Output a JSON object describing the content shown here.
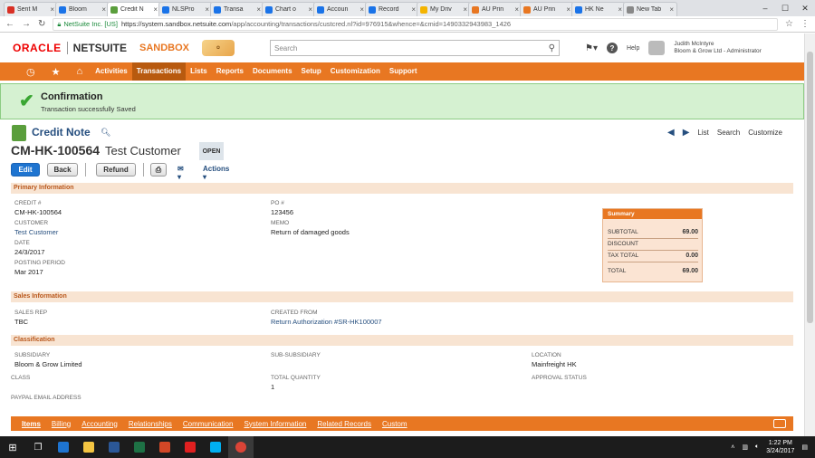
{
  "browser": {
    "tabs": [
      {
        "label": "Sent M",
        "color": "#d93025",
        "active": false
      },
      {
        "label": "Bloom",
        "color": "#1a73e8",
        "active": false
      },
      {
        "label": "Credit N",
        "color": "#5a9e3c",
        "active": true
      },
      {
        "label": "NLSPro",
        "color": "#1a73e8",
        "active": false
      },
      {
        "label": "Transa",
        "color": "#1a73e8",
        "active": false
      },
      {
        "label": "Chart o",
        "color": "#1a73e8",
        "active": false
      },
      {
        "label": "Accoun",
        "color": "#1a73e8",
        "active": false
      },
      {
        "label": "Record",
        "color": "#1a73e8",
        "active": false
      },
      {
        "label": "My Driv",
        "color": "#f4b400",
        "active": false
      },
      {
        "label": "AU Prin",
        "color": "#e87722",
        "active": false
      },
      {
        "label": "AU Prin",
        "color": "#e87722",
        "active": false
      },
      {
        "label": "HK Ne",
        "color": "#1a73e8",
        "active": false
      },
      {
        "label": "New Tab",
        "color": "#888888",
        "active": false
      }
    ],
    "url_secure": "NetSuite Inc. [US]",
    "url_host": "https://system.sandbox.netsuite.com",
    "url_path": "/app/accounting/transactions/custcred.nl?id=976915&whence=&cmid=1490332943983_1426"
  },
  "header": {
    "oracle": "ORACLE",
    "netsuite": "NETSUITE",
    "sandbox": "SANDBOX",
    "search_placeholder": "Search",
    "help": "Help",
    "user_name": "Judith McIntyre",
    "user_role": "Bloom & Grow Ltd - Administrator"
  },
  "nav": {
    "items": [
      "Activities",
      "Transactions",
      "Lists",
      "Reports",
      "Documents",
      "Setup",
      "Customization",
      "Support"
    ],
    "active": "Transactions"
  },
  "confirmation": {
    "title": "Confirmation",
    "subtitle": "Transaction successfully Saved"
  },
  "record": {
    "type": "Credit Note",
    "number": "CM-HK-100564",
    "customer": "Test Customer",
    "status": "OPEN",
    "nav_links": [
      "List",
      "Search",
      "Customize"
    ]
  },
  "buttons": {
    "edit": "Edit",
    "back": "Back",
    "refund": "Refund",
    "actions": "Actions"
  },
  "primary": {
    "heading": "Primary Information",
    "credit_label": "CREDIT #",
    "credit_value": "CM-HK-100564",
    "customer_label": "CUSTOMER",
    "customer_value": "Test Customer",
    "date_label": "DATE",
    "date_value": "24/3/2017",
    "period_label": "POSTING PERIOD",
    "period_value": "Mar 2017",
    "po_label": "PO #",
    "po_value": "123456",
    "memo_label": "MEMO",
    "memo_value": "Return of damaged goods"
  },
  "summary": {
    "heading": "Summary",
    "subtotal_label": "SUBTOTAL",
    "subtotal_value": "69.00",
    "discount_label": "DISCOUNT",
    "tax_label": "TAX TOTAL",
    "tax_value": "0.00",
    "total_label": "TOTAL",
    "total_value": "69.00"
  },
  "sales": {
    "heading": "Sales Information",
    "rep_label": "SALES REP",
    "rep_value": "TBC",
    "created_label": "CREATED FROM",
    "created_value": "Return Authorization #SR-HK100007"
  },
  "classification": {
    "heading": "Classification",
    "subsidiary_label": "SUBSIDIARY",
    "subsidiary_value": "Bloom & Grow Limited",
    "subsub_label": "SUB-SUBSIDIARY",
    "location_label": "LOCATION",
    "location_value": "Mainfreight HK",
    "class_label": "CLASS",
    "qty_label": "TOTAL QUANTITY",
    "qty_value": "1",
    "approval_label": "APPROVAL STATUS",
    "paypal_label": "PAYPAL EMAIL ADDRESS"
  },
  "subtabs": [
    "Items",
    "Billing",
    "Accounting",
    "Relationships",
    "Communication",
    "System Information",
    "Related Records",
    "Custom"
  ],
  "taskbar": {
    "time": "1:22 PM",
    "date": "3/24/2017",
    "icons": [
      {
        "name": "edge",
        "color": "#1e74d0"
      },
      {
        "name": "explorer",
        "color": "#f4c542"
      },
      {
        "name": "word",
        "color": "#2b5797"
      },
      {
        "name": "excel",
        "color": "#1e7145"
      },
      {
        "name": "powerpoint",
        "color": "#d24726"
      },
      {
        "name": "acrobat",
        "color": "#e02020"
      },
      {
        "name": "skype",
        "color": "#00aff0"
      },
      {
        "name": "chrome",
        "color": "#db4437"
      }
    ]
  }
}
